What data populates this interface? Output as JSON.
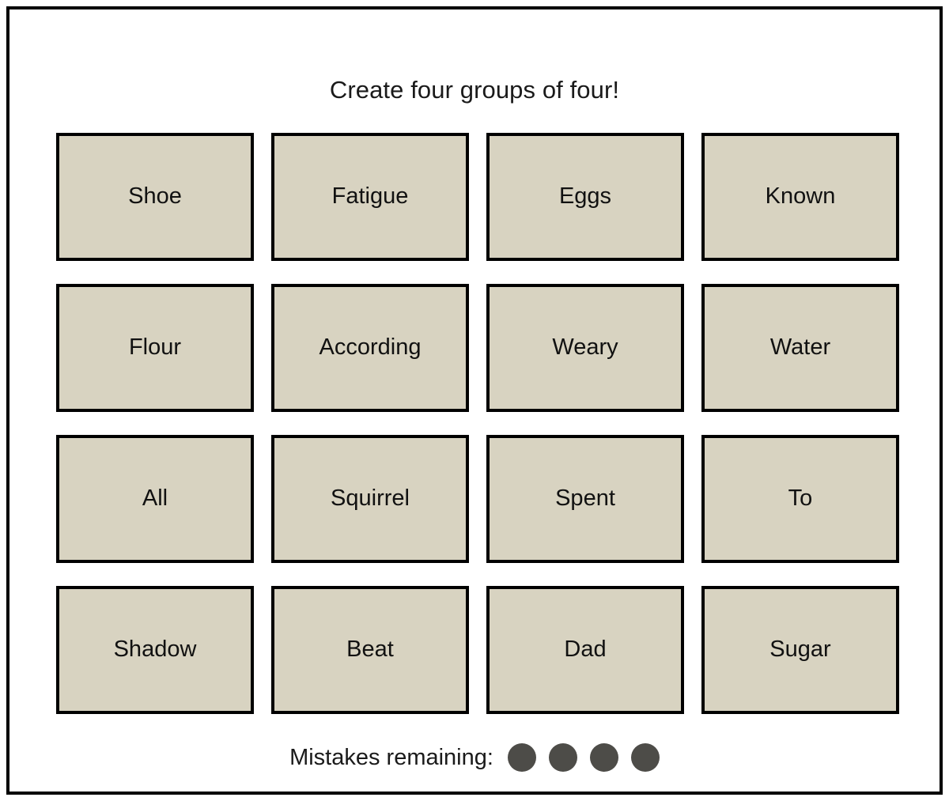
{
  "board": {
    "title": "Create four groups of four!",
    "tile_fill_color": "#d8d3c1",
    "tile_border_color": "#000000",
    "frame_border_color": "#000000",
    "background_color": "#ffffff",
    "rows": 4,
    "columns": 4,
    "tiles": [
      {
        "label": "Shoe"
      },
      {
        "label": "Fatigue"
      },
      {
        "label": "Eggs"
      },
      {
        "label": "Known"
      },
      {
        "label": "Flour"
      },
      {
        "label": "According"
      },
      {
        "label": "Weary"
      },
      {
        "label": "Water"
      },
      {
        "label": "All"
      },
      {
        "label": "Squirrel"
      },
      {
        "label": "Spent"
      },
      {
        "label": "To"
      },
      {
        "label": "Shadow"
      },
      {
        "label": "Beat"
      },
      {
        "label": "Dad"
      },
      {
        "label": "Sugar"
      }
    ]
  },
  "mistakes": {
    "label": "Mistakes remaining:",
    "remaining": 4,
    "dot_color": "#4d4c48",
    "dots": [
      {
        "name": "mistake-dot-1"
      },
      {
        "name": "mistake-dot-2"
      },
      {
        "name": "mistake-dot-3"
      },
      {
        "name": "mistake-dot-4"
      }
    ]
  }
}
